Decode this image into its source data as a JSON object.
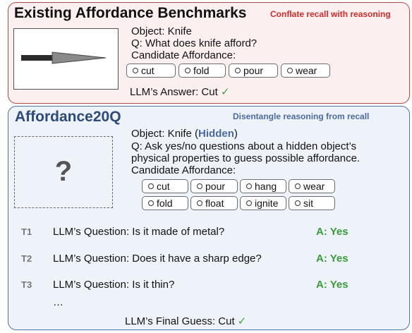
{
  "top": {
    "title": "Existing Affordance Benchmarks",
    "subtitle": "Conflate recall with reasoning",
    "object_line": "Object: Knife",
    "question_line": "Q: What does knife afford?",
    "candidate_label": "Candidate Affordance:",
    "chips": [
      "cut",
      "fold",
      "pour",
      "wear"
    ],
    "answer_text": "LLM’s Answer: Cut",
    "answer_mark": "✓"
  },
  "bottom": {
    "title": "Affordance20Q",
    "subtitle": "Disentangle reasoning from recall",
    "placeholder_mark": "?",
    "object_prefix": "Object: Knife (",
    "object_hidden": "Hidden",
    "object_suffix": ")",
    "question_line1": "Q:  Ask yes/no questions about a hidden object’s",
    "question_line2": "physical properties to guess possible affordance.",
    "candidate_label": "Candidate Affordance:",
    "chips_row1": [
      "cut",
      "pour",
      "hang",
      "wear"
    ],
    "chips_row2": [
      "fold",
      "float",
      "ignite",
      "sit"
    ],
    "turns": [
      {
        "id": "T1",
        "question": "LLM’s Question: Is it made of metal?",
        "answer": "A: Yes"
      },
      {
        "id": "T2",
        "question": "LLM’s Question: Does it have a sharp edge?",
        "answer": "A: Yes"
      },
      {
        "id": "T3",
        "question": "LLM’s Question: Is it thin?",
        "answer": "A: Yes"
      }
    ],
    "ellipsis": "…",
    "final_text": "LLM’s Final Guess: Cut",
    "final_mark": "✓"
  },
  "colors": {
    "top_border": "#b24a45",
    "top_fill": "#fbf0ef",
    "top_subtitle": "#d42a2a",
    "bottom_border": "#4f74a8",
    "bottom_fill": "#eef3fa",
    "bottom_title": "#2c4a7a",
    "bottom_subtitle": "#4a6aa0",
    "hidden_word": "#4a6aa0",
    "answer_green": "#3a9a3a"
  }
}
